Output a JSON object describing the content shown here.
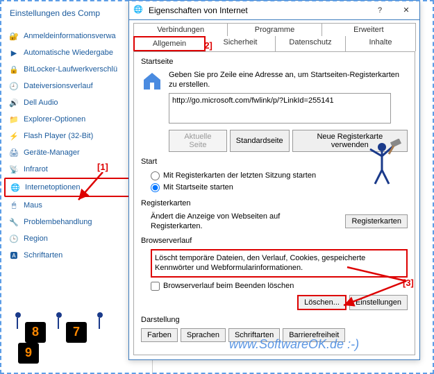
{
  "control_panel": {
    "title": "Einstellungen des Comp",
    "items": [
      "Anmeldeinformationsverwa",
      "Automatische Wiedergabe",
      "BitLocker-Laufwerkverschlü",
      "Dateiversionsverlauf",
      "Dell Audio",
      "Explorer-Optionen",
      "Flash Player (32-Bit)",
      "Geräte-Manager",
      "Infrarot",
      "Internetoptionen",
      "Maus",
      "Problembehandlung",
      "Region",
      "Schriftarten"
    ],
    "selected_index": 9
  },
  "dialog": {
    "title": "Eigenschaften von Internet",
    "tabs_row1": [
      "Verbindungen",
      "Programme",
      "Erweitert"
    ],
    "tabs_row2": [
      "Allgemein",
      "Sicherheit",
      "Datenschutz",
      "Inhalte"
    ],
    "active_tab": "Allgemein",
    "startseite": {
      "label": "Startseite",
      "desc": "Geben Sie pro Zeile eine Adresse an, um Startseiten-Registerkarten zu erstellen.",
      "url": "http://go.microsoft.com/fwlink/p/?LinkId=255141",
      "btn_current": "Aktuelle Seite",
      "btn_default": "Standardseite",
      "btn_newtab": "Neue Registerkarte verwenden"
    },
    "start": {
      "label": "Start",
      "opt1": "Mit Registerkarten der letzten Sitzung starten",
      "opt2": "Mit Startseite starten"
    },
    "regcards": {
      "label": "Registerkarten",
      "desc": "Ändert die Anzeige von Webseiten auf Registerkarten.",
      "btn": "Registerkarten"
    },
    "browserverlauf": {
      "label": "Browserverlauf",
      "desc": "Löscht temporäre Dateien, den Verlauf, Cookies, gespeicherte Kennwörter und Webformularinformationen.",
      "cb": "Browserverlauf beim Beenden löschen",
      "btn_delete": "Löschen...",
      "btn_settings": "Einstellungen"
    },
    "darstellung": {
      "label": "Darstellung",
      "btn_colors": "Farben",
      "btn_lang": "Sprachen",
      "btn_fonts": "Schriftarten",
      "btn_access": "Barrierefreiheit"
    }
  },
  "annotations": {
    "a1": "[1]",
    "a2": "[2]",
    "a3": "[3]"
  },
  "watermark": "www.SoftwareOK.de :-)",
  "scores": [
    "8",
    "7",
    "9"
  ]
}
